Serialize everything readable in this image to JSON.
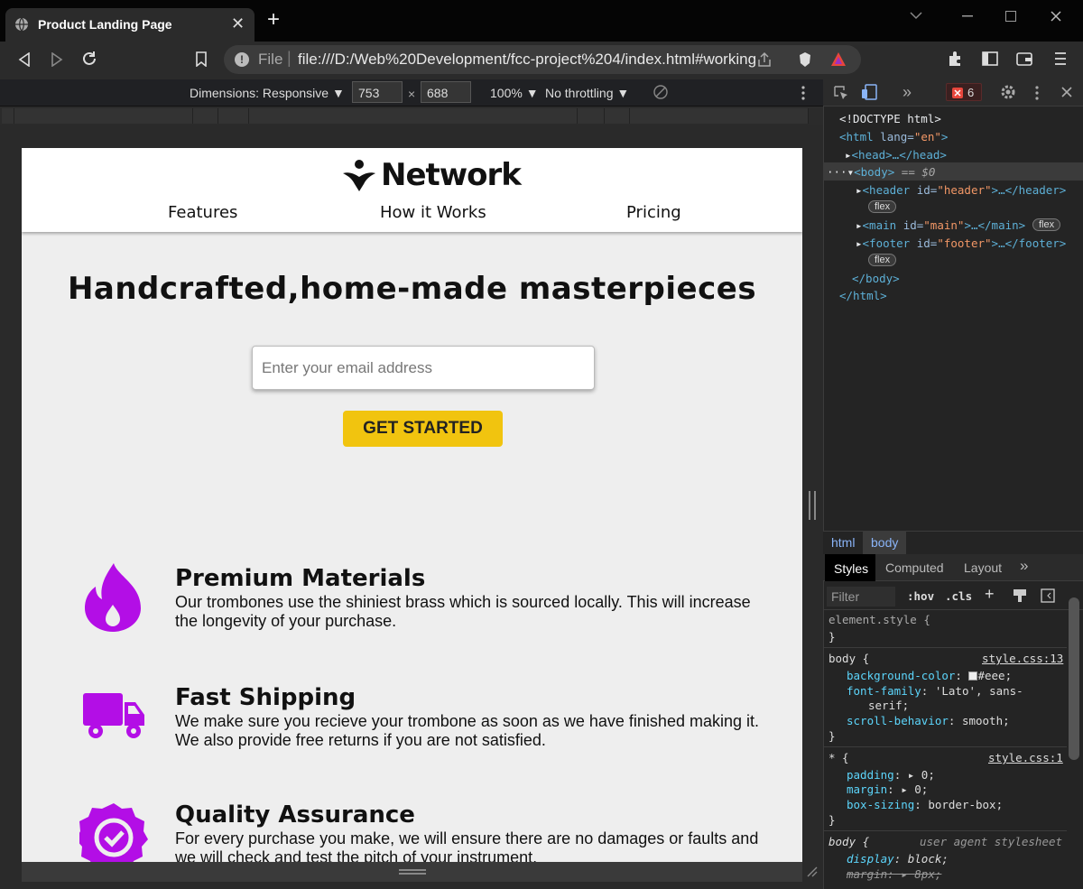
{
  "browser": {
    "tab_title": "Product Landing Page",
    "new_tab": "+",
    "close": "✕",
    "file_label": "File",
    "url": "file:///D:/Web%20Development/fcc-project%204/index.html#working"
  },
  "device_toolbar": {
    "dimensions": "Dimensions: Responsive ▼",
    "width": "753",
    "times": "×",
    "height": "688",
    "zoom": "100% ▼",
    "throttle": "No throttling ▼"
  },
  "page": {
    "logo_text": "Network",
    "nav": [
      "Features",
      "How it Works",
      "Pricing"
    ],
    "hero_title": "Handcrafted,home-made masterpieces",
    "email_placeholder": "Enter your email address",
    "cta": "GET STARTED",
    "features": [
      {
        "title": "Premium Materials",
        "text": "Our trombones use the shiniest brass which is sourced locally. This will increase the longevity of your purchase.",
        "icon": "fire-icon"
      },
      {
        "title": "Fast Shipping",
        "text": "We make sure you recieve your trombone as soon as we have finished making it. We also provide free returns if you are not satisfied.",
        "icon": "truck-icon"
      },
      {
        "title": "Quality Assurance",
        "text": "For every purchase you make, we will ensure there are no damages or faults and we will check and test the pitch of your instrument.",
        "icon": "certificate-check-icon"
      }
    ],
    "icon_color": "#b30ee6",
    "cta_color": "#f1c40f"
  },
  "devtools": {
    "error_count": "6",
    "dom": {
      "doctype": "<!DOCTYPE html>",
      "html_open": "<html",
      "lang_attr": "lang=",
      "lang_val": "\"en\"",
      "gt": ">",
      "head": "<head>…</head>",
      "body_open": "<body>",
      "body_eq": "== $0",
      "header_tag": "<header",
      "header_attr": "id=",
      "header_val": "\"header\"",
      "header_close": ">…</header>",
      "main_tag": "<main",
      "main_attr": "id=",
      "main_val": "\"main\"",
      "main_close": ">…</main>",
      "footer_tag": "<footer",
      "footer_attr": "id=",
      "footer_val": "\"footer\"",
      "footer_close": ">…</footer>",
      "body_close": "</body>",
      "html_close": "</html>",
      "flex": "flex"
    },
    "crumbs": [
      "html",
      "body"
    ],
    "tabs": [
      "Styles",
      "Computed",
      "Layout",
      "»"
    ],
    "filter_placeholder": "Filter",
    "hov": ":hov",
    "cls": ".cls",
    "rules": {
      "element_style": "element.style {",
      "close": "}",
      "body_sel": "body {",
      "body_src": "style.css:13",
      "bg_prop": "background-color",
      "bg_val": "#eee;",
      "ff_prop": "font-family",
      "ff_val": "'Lato', sans-",
      "ff_val2": "serif;",
      "sb_prop": "scroll-behavior",
      "sb_val": "smooth;",
      "star_sel": "* {",
      "star_src": "style.css:1",
      "pad_prop": "padding",
      "pad_val": "0;",
      "mar_prop": "margin",
      "mar_val": "0;",
      "bs_prop": "box-sizing",
      "bs_val": "border-box;",
      "ua_sel": "body {",
      "ua_src": "user agent stylesheet",
      "disp_prop": "display",
      "disp_val": "block;",
      "uam_prop": "margin",
      "uam_val": "8px;"
    }
  }
}
